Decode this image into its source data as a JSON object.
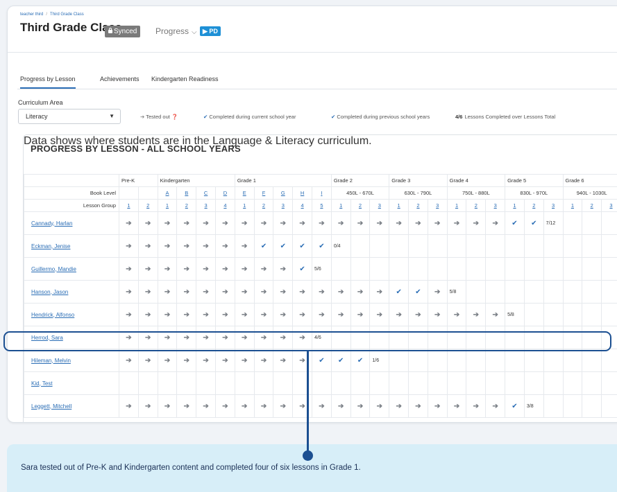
{
  "breadcrumb": [
    "teacher third",
    "Third Grade Class"
  ],
  "header": {
    "title": "Third Grade Class",
    "synced_label": "Synced",
    "progress_label": "Progress",
    "pd_label": "▶ PD"
  },
  "tabs": [
    {
      "label": "Progress by Lesson",
      "active": true
    },
    {
      "label": "Achievements",
      "active": false
    },
    {
      "label": "Kindergarten Readiness",
      "active": false
    }
  ],
  "filters": {
    "curriculum_label": "Curriculum Area",
    "curriculum_value": "Literacy"
  },
  "legend": {
    "tested_out": "Tested out",
    "completed_current": "Completed during current school year",
    "completed_previous": "Completed during previous school years",
    "ratio_example": "4/6",
    "ratio_label": "Lessons Completed over Lessons Total"
  },
  "section": {
    "title": "PROGRESS BY LESSON - ALL SCHOOL YEARS",
    "subtitle": "Data shows where students are in the Language & Literacy curriculum."
  },
  "grid": {
    "grade_groups": [
      {
        "label": "Pre-K",
        "span": 2
      },
      {
        "label": "Kindergarten",
        "span": 4
      },
      {
        "label": "Grade 1",
        "span": 5
      },
      {
        "label": "Grade 2",
        "span": 3
      },
      {
        "label": "Grade 3",
        "span": 3
      },
      {
        "label": "Grade 4",
        "span": 3
      },
      {
        "label": "Grade 5",
        "span": 3
      },
      {
        "label": "Grade 6",
        "span": 3
      }
    ],
    "book_level_label": "Book Level",
    "book_levels": [
      {
        "label": "",
        "span": 1
      },
      {
        "label": "",
        "span": 1
      },
      {
        "label": "A",
        "span": 1
      },
      {
        "label": "B",
        "span": 1
      },
      {
        "label": "C",
        "span": 1
      },
      {
        "label": "D",
        "span": 1
      },
      {
        "label": "E",
        "span": 1
      },
      {
        "label": "F",
        "span": 1
      },
      {
        "label": "G",
        "span": 1
      },
      {
        "label": "H",
        "span": 1
      },
      {
        "label": "I",
        "span": 1
      },
      {
        "label": "450L - 670L",
        "span": 3
      },
      {
        "label": "630L - 790L",
        "span": 3
      },
      {
        "label": "750L - 880L",
        "span": 3
      },
      {
        "label": "830L - 970L",
        "span": 3
      },
      {
        "label": "940L - 1030L",
        "span": 3
      }
    ],
    "lesson_group_label": "Lesson Group",
    "lesson_groups": [
      "1",
      "2",
      "1",
      "2",
      "3",
      "4",
      "1",
      "2",
      "3",
      "4",
      "5",
      "1",
      "2",
      "3",
      "1",
      "2",
      "3",
      "1",
      "2",
      "3",
      "1",
      "2",
      "3",
      "1",
      "2",
      "3"
    ],
    "students": [
      {
        "name": "Cannady, Harlan",
        "cells": [
          "a",
          "a",
          "a",
          "a",
          "a",
          "a",
          "a",
          "a",
          "a",
          "a",
          "a",
          "a",
          "a",
          "a",
          "a",
          "a",
          "a",
          "a",
          "a",
          "a",
          "c",
          "c",
          "7/12",
          "",
          "",
          ""
        ]
      },
      {
        "name": "Eckman, Jenise",
        "cells": [
          "a",
          "a",
          "a",
          "a",
          "a",
          "a",
          "a",
          "c",
          "c",
          "c",
          "c",
          "0/4",
          "",
          "",
          "",
          "",
          "",
          "",
          "",
          "",
          "",
          "",
          "",
          "",
          "",
          ""
        ]
      },
      {
        "name": "Guillermo, Mandie",
        "cells": [
          "a",
          "a",
          "a",
          "a",
          "a",
          "a",
          "a",
          "a",
          "a",
          "c",
          "5/6",
          "",
          "",
          "",
          "",
          "",
          "",
          "",
          "",
          "",
          "",
          "",
          "",
          "",
          "",
          ""
        ]
      },
      {
        "name": "Hanson, Jason",
        "cells": [
          "a",
          "a",
          "a",
          "a",
          "a",
          "a",
          "a",
          "a",
          "a",
          "a",
          "a",
          "a",
          "a",
          "a",
          "c",
          "c",
          "a",
          "5/8",
          "",
          "",
          "",
          "",
          "",
          "",
          "",
          ""
        ]
      },
      {
        "name": "Hendrick, Alfonso",
        "cells": [
          "a",
          "a",
          "a",
          "a",
          "a",
          "a",
          "a",
          "a",
          "a",
          "a",
          "a",
          "a",
          "a",
          "a",
          "a",
          "a",
          "a",
          "a",
          "a",
          "a",
          "5/8",
          "",
          "",
          "",
          "",
          ""
        ]
      },
      {
        "name": "Herrod, Sara",
        "cells": [
          "a",
          "a",
          "a",
          "a",
          "a",
          "a",
          "a",
          "a",
          "a",
          "a",
          "4/6",
          "",
          "",
          "",
          "",
          "",
          "",
          "",
          "",
          "",
          "",
          "",
          "",
          "",
          "",
          ""
        ]
      },
      {
        "name": "Hileman, Melvin",
        "cells": [
          "a",
          "a",
          "a",
          "a",
          "a",
          "a",
          "a",
          "a",
          "a",
          "a",
          "c",
          "c",
          "c",
          "1/6",
          "",
          "",
          "",
          "",
          "",
          "",
          "",
          "",
          "",
          "",
          "",
          ""
        ]
      },
      {
        "name": "Kid, Test",
        "cells": [
          "",
          "",
          "",
          "",
          "",
          "",
          "",
          "",
          "",
          "",
          "",
          "",
          "",
          "",
          "",
          "",
          "",
          "",
          "",
          "",
          "",
          "",
          "",
          "",
          "",
          ""
        ]
      },
      {
        "name": "Leggett, Mitchell",
        "cells": [
          "a",
          "a",
          "a",
          "a",
          "a",
          "a",
          "a",
          "a",
          "a",
          "a",
          "a",
          "a",
          "a",
          "a",
          "a",
          "a",
          "a",
          "a",
          "a",
          "a",
          "c",
          "3/8",
          "",
          "",
          "",
          ""
        ]
      }
    ]
  },
  "callout": {
    "text": "Sara tested out of Pre-K and Kindergarten content and completed four of six lessons in Grade 1."
  },
  "icons": {
    "tested_out": "arrow-right-icon",
    "completed_current": "check-icon",
    "completed_previous": "double-check-icon",
    "info": "info-icon",
    "lock": "lock-icon",
    "chevron": "chevron-down-icon"
  },
  "colors": {
    "link_blue": "#2a6db5",
    "highlight_navy": "#1b4f91",
    "callout_bg": "#d7eef8",
    "pd_blue": "#1e90d6"
  }
}
